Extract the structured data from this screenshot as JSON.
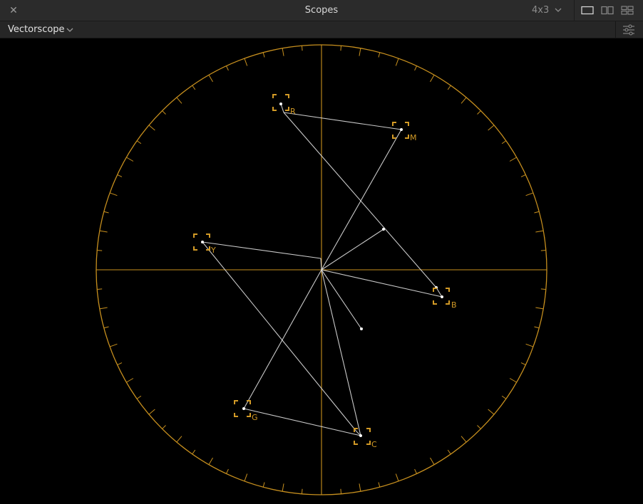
{
  "window": {
    "title": "Scopes",
    "aspect_label": "4x3",
    "close_glyph": "✕",
    "layout_options": [
      "single-view",
      "dual-view",
      "quad-view"
    ]
  },
  "toolbar": {
    "scope_type": "Vectorscope"
  },
  "colors": {
    "graticule": "#c8901e",
    "trace": "#e0e0e0",
    "target": "#d29a26"
  },
  "targets": [
    {
      "label": "R"
    },
    {
      "label": "M"
    },
    {
      "label": "Y"
    },
    {
      "label": "B"
    },
    {
      "label": "G"
    },
    {
      "label": "C"
    }
  ]
}
